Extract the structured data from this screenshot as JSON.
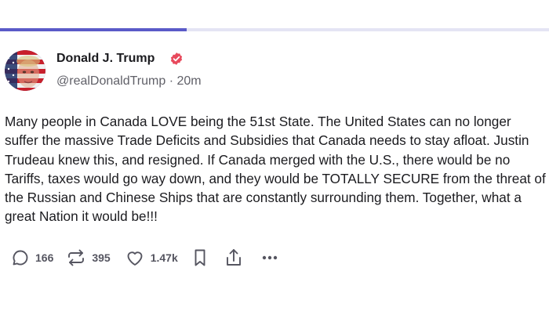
{
  "progress": {
    "fraction": 0.34,
    "fill_color": "#5a5ac8",
    "track_color": "#e4e4f4"
  },
  "post": {
    "author": {
      "name": "Donald J. Trump",
      "verified": true,
      "verified_color": "#e8495c",
      "avatar": "avatar-portrait-flag"
    },
    "handle": "@realDonaldTrump",
    "separator": "·",
    "time": "20m",
    "text": "Many people in Canada LOVE being the 51st State. The United States can no longer suffer the massive Trade Deficits and Subsidies that Canada needs to stay afloat. Justin Trudeau knew this, and resigned. If Canada merged with the U.S., there would be no Tariffs, taxes would go way down, and they would be TOTALLY SECURE from the threat of the Russian and Chinese Ships that are constantly surrounding them. Together, what a great Nation it would be!!!",
    "actions": {
      "replies": {
        "icon": "reply-icon",
        "count": "166"
      },
      "retruths": {
        "icon": "retruth-icon",
        "count": "395"
      },
      "likes": {
        "icon": "heart-icon",
        "count": "1.47k"
      },
      "save": {
        "icon": "bookmark-icon"
      },
      "share": {
        "icon": "share-icon"
      },
      "more": {
        "icon": "more-icon"
      }
    }
  }
}
